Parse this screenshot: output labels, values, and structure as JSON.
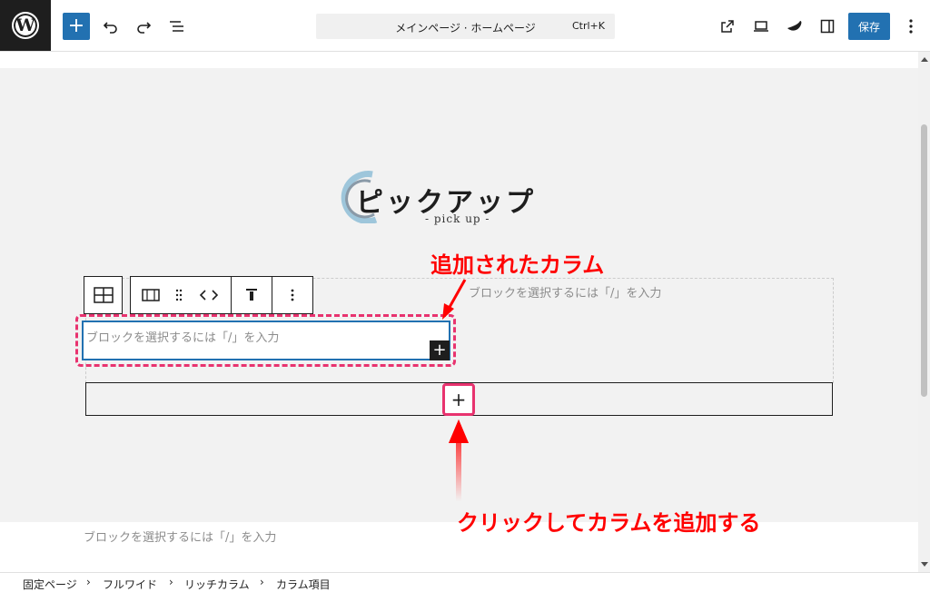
{
  "toolbar": {
    "command_title": "メインページ · ホームページ",
    "shortcut": "Ctrl+K",
    "save_label": "保存",
    "add_symbol": "+",
    "accent_color": "#2271b1"
  },
  "canvas": {
    "logo_title": "ピックアップ",
    "logo_subtitle": "- pick up -",
    "placeholder_right": "ブロックを選択するには「/」を入力",
    "placeholder_new_column": "ブロックを選択するには「/」を入力",
    "placeholder_bottom": "ブロックを選択するには「/」を入力",
    "inline_add_symbol": "+",
    "append_symbol": "+"
  },
  "annotations": {
    "top": "追加されたカラム",
    "bottom": "クリックしてカラムを追加する",
    "highlight_color": "#e8336f",
    "text_color": "#ff0000"
  },
  "breadcrumb": {
    "items": [
      "固定ページ",
      "フルワイド",
      "リッチカラム",
      "カラム項目"
    ],
    "separator": "›"
  }
}
